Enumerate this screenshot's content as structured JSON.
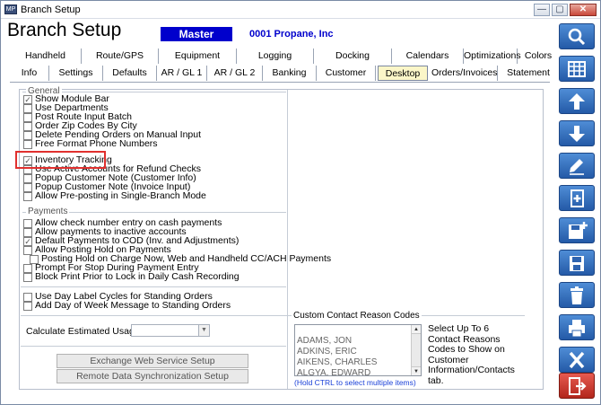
{
  "window": {
    "title": "Branch Setup",
    "app_icon_text": "MP",
    "controls": {
      "minimize": "—",
      "maximize": "▢",
      "close": "✕"
    }
  },
  "header": {
    "title": "Branch Setup",
    "branch": "Master Branch",
    "company": "0001  Propane, Inc"
  },
  "tabs_row1": [
    "Handheld",
    "Route/GPS",
    "Equipment",
    "Logging",
    "Docking",
    "Calendars",
    "Optimizations",
    "Colors"
  ],
  "tabs_row2": [
    "Info",
    "Settings",
    "Defaults",
    "AR / GL 1",
    "AR / GL 2",
    "Banking",
    "Customer",
    "Desktop",
    "Orders/Invoices",
    "Statement"
  ],
  "active_tab": "Desktop",
  "general": {
    "label": "General",
    "items": [
      {
        "label": "Show Module Bar",
        "checked": true
      },
      {
        "label": "Use Departments",
        "checked": false
      },
      {
        "label": "Post Route Input Batch",
        "checked": false
      },
      {
        "label": "Order Zip Codes By City",
        "checked": false
      },
      {
        "label": "Delete Pending Orders on Manual Input",
        "checked": false
      },
      {
        "label": "Free Format Phone Numbers",
        "checked": false
      }
    ],
    "items2": [
      {
        "label": "Inventory Tracking",
        "checked": true
      },
      {
        "label": "Use Active Accounts for Refund Checks",
        "checked": false
      },
      {
        "label": "Popup Customer Note (Customer Info)",
        "checked": false
      },
      {
        "label": "Popup Customer Note (Invoice Input)",
        "checked": false
      },
      {
        "label": "Allow Pre-posting in Single-Branch Mode",
        "checked": false
      }
    ]
  },
  "payments": {
    "label": "Payments",
    "items": [
      {
        "label": "Allow check number entry on cash payments",
        "checked": false
      },
      {
        "label": "Allow payments to inactive accounts",
        "checked": false
      },
      {
        "label": "Default Payments to COD (Inv. and Adjustments)",
        "checked": true
      },
      {
        "label": "Allow Posting Hold on Payments",
        "checked": false
      },
      {
        "label": "Posting Hold on Charge Now, Web and Handheld CC/ACH Payments",
        "checked": false
      },
      {
        "label": "Prompt For Stop During Payment Entry",
        "checked": false
      },
      {
        "label": "Block Print Prior to Lock in Daily Cash Recording",
        "checked": false
      }
    ]
  },
  "standing": {
    "items": [
      {
        "label": "Use Day Label Cycles for Standing Orders",
        "checked": false
      },
      {
        "label": "Add Day of Week Message to Standing Orders",
        "checked": false
      }
    ]
  },
  "usage": {
    "label": "Calculate Estimated Usage In",
    "value": ""
  },
  "buttons": {
    "exchange": "Exchange Web Service Setup",
    "remote": "Remote Data Synchronization Setup"
  },
  "contact": {
    "label": "Custom Contact Reason Codes",
    "list": [
      "",
      "ADAMS, JON",
      "ADKINS, ERIC",
      "AIKENS, CHARLES",
      "ALGYA, EDWARD"
    ],
    "hint": "(Hold CTRL to select multiple items)",
    "info": "Select Up To 6 Contact Reasons Codes to Show on Customer Information/Contacts tab."
  },
  "toolbar": [
    "search-icon",
    "grid-icon",
    "arrow-up-icon",
    "arrow-down-icon",
    "pencil-icon",
    "new-document-icon",
    "save-new-icon",
    "save-icon",
    "trash-icon",
    "print-icon",
    "close-x-icon",
    "exit-door-icon"
  ]
}
